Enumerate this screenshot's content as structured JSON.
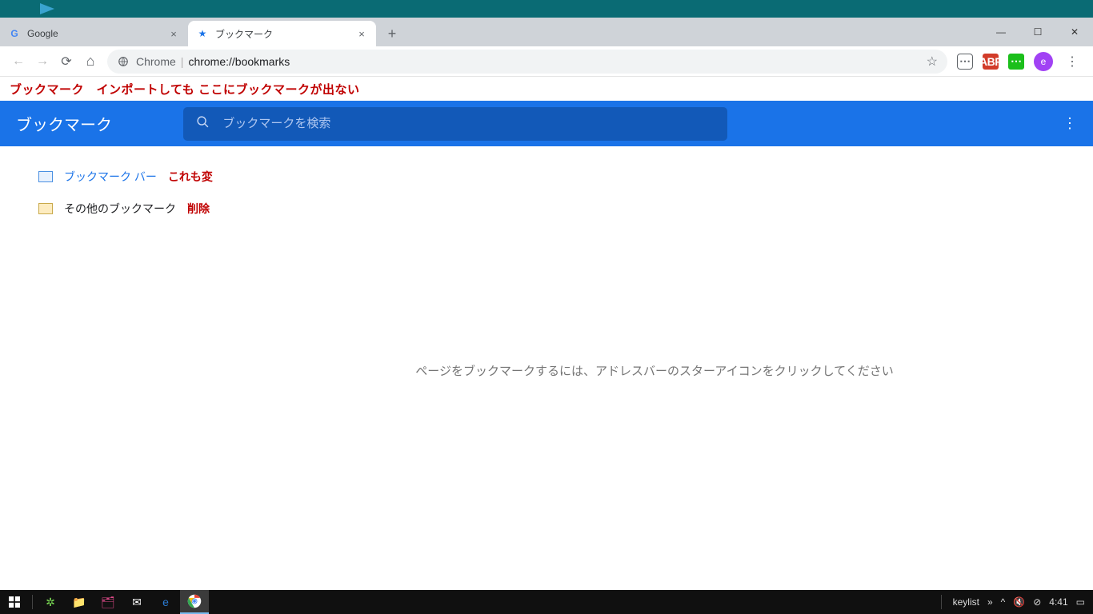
{
  "tabs": [
    {
      "title": "Google"
    },
    {
      "title": "ブックマーク"
    }
  ],
  "window_controls": {
    "min": "—",
    "max": "☐",
    "close": "✕"
  },
  "nav": {
    "back": "←",
    "fwd": "→",
    "reload": "⟳",
    "home": "⌂"
  },
  "omnibox": {
    "origin": "Chrome",
    "path": "chrome://bookmarks"
  },
  "profile_initial": "e",
  "annotation_top": "ブックマーク　インポートしても ここにブックマークが出ない",
  "bm": {
    "title": "ブックマーク",
    "search_placeholder": "ブックマークを検索",
    "items": [
      {
        "label": "ブックマーク バー",
        "note": "これも変"
      },
      {
        "label": "その他のブックマーク",
        "note": "削除"
      }
    ],
    "empty": "ページをブックマークするには、アドレスバーのスターアイコンをクリックしてください"
  },
  "tray": {
    "keylist": "keylist",
    "time": "4:41"
  }
}
